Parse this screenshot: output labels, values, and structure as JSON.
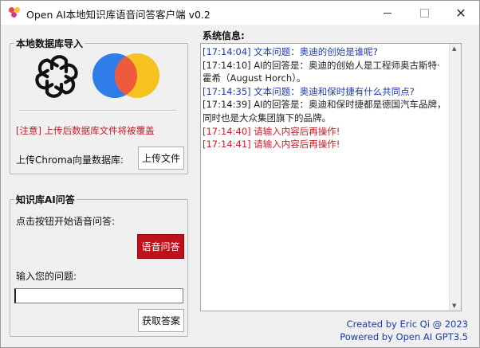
{
  "window": {
    "title": "Open AI本地知识库语音问答客户端 v0.2",
    "minimize_glyph": "—",
    "close_glyph": "✕"
  },
  "import_group": {
    "title": "本地数据库导入",
    "warning": "[注意] 上传后数据库文件将被覆盖",
    "upload_label": "上传Chroma向量数据库:",
    "upload_button": "上传文件"
  },
  "qa_group": {
    "title": "知识库AI问答",
    "voice_hint": "点击按钮开始语音问答:",
    "voice_button": "语音问答",
    "question_label": "输入您的问题:",
    "question_value": "",
    "submit_button": "获取答案"
  },
  "system_info": {
    "title": "系统信息:",
    "lines": [
      {
        "text": "[17:14:04] 文本问题：奥迪的创始是谁呢?",
        "color": "blue"
      },
      {
        "text": "[17:14:10] AI的回答是：奥迪的创始人是工程师奥古斯特·霍希（August Horch）。",
        "color": "dark"
      },
      {
        "text": "[17:14:35] 文本问题：奥迪和保时捷有什么共同点?",
        "color": "blue"
      },
      {
        "text": "[17:14:39] AI的回答是：奥迪和保时捷都是德国汽车品牌，同时也是大众集团旗下的品牌。",
        "color": "dark"
      },
      {
        "text": "[17:14:40] 请输入内容后再操作!",
        "color": "red"
      },
      {
        "text": "[17:14:41] 请输入内容后再操作!",
        "color": "red"
      }
    ]
  },
  "credits": {
    "created_by": "Created by Eric Qi @ 2023",
    "powered_by": "Powered by Open AI GPT3.5"
  },
  "colors": {
    "warning_red": "#c0202a",
    "log_blue": "#1a3aa8",
    "voice_button_bg": "#c0101a",
    "venn_blue": "#2f7de8",
    "venn_yellow": "#f5c21f",
    "venn_red": "#ee5a3c"
  },
  "icons": {
    "app_icon": "app-logo-icon",
    "openai_logo": "openai-logo-icon",
    "venn_logo": "venn-logo-icon"
  }
}
